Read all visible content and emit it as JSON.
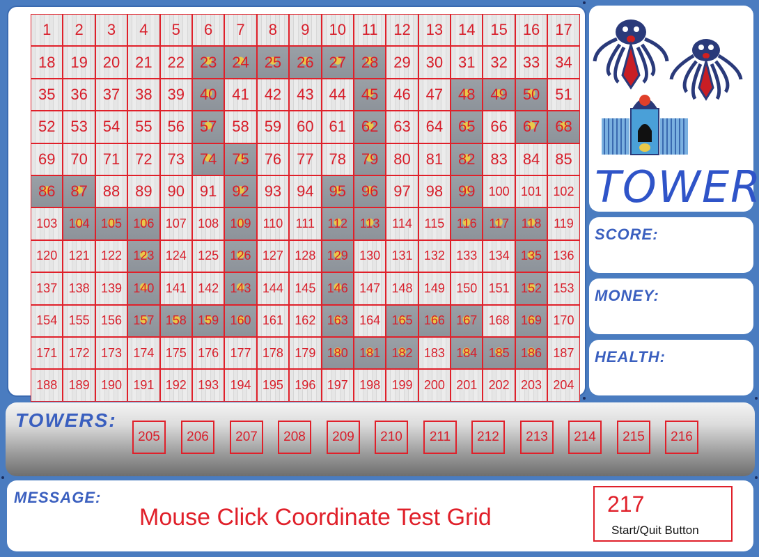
{
  "game_title": "TOWER-D",
  "stats": {
    "score_label": "SCORE:",
    "money_label": "MONEY:",
    "health_label": "HEALTH:"
  },
  "towers_label": "TOWERS:",
  "tower_slots": [
    "205",
    "206",
    "207",
    "208",
    "209",
    "210",
    "211",
    "212",
    "213",
    "214",
    "215",
    "216"
  ],
  "message_label": "MESSAGE:",
  "message_text": "Mouse Click Coordinate Test Grid",
  "start_button": {
    "number": "217",
    "label": "Start/Quit Button"
  },
  "grid": {
    "columns": 17,
    "rows": 12,
    "path_cells": [
      23,
      24,
      25,
      26,
      27,
      28,
      40,
      45,
      48,
      49,
      50,
      57,
      62,
      65,
      67,
      68,
      74,
      75,
      79,
      82,
      86,
      87,
      92,
      95,
      96,
      99,
      104,
      105,
      106,
      109,
      112,
      113,
      116,
      117,
      118,
      123,
      126,
      129,
      135,
      140,
      143,
      146,
      152,
      157,
      158,
      159,
      160,
      163,
      165,
      166,
      167,
      169,
      180,
      181,
      182,
      184,
      185,
      186
    ]
  },
  "colors": {
    "frame": "#4a7cc0",
    "accent_red": "#e0202a",
    "label_blue": "#3a5fbf"
  },
  "icons": [
    "monster-sprite-icon",
    "monster-sprite-icon",
    "tower-sprite-icon"
  ]
}
